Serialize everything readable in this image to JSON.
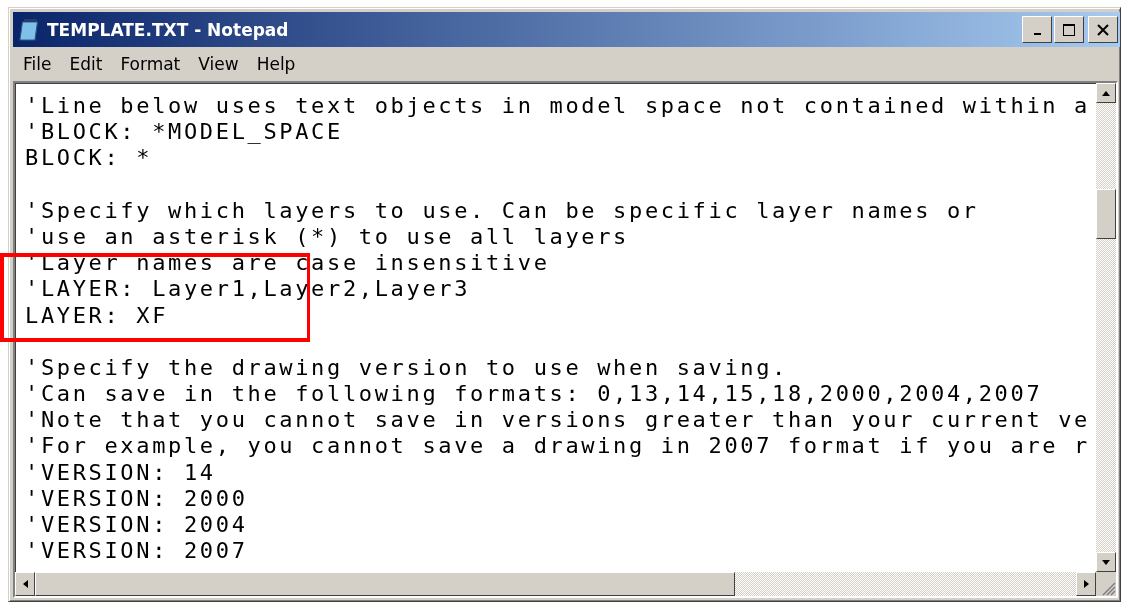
{
  "window": {
    "title": "TEMPLATE.TXT - Notepad"
  },
  "menu": [
    {
      "label": "File"
    },
    {
      "label": "Edit"
    },
    {
      "label": "Format"
    },
    {
      "label": "View"
    },
    {
      "label": "Help"
    }
  ],
  "editor": {
    "lines": [
      {
        "kind": "text",
        "text": "'Line below uses text objects in model space not contained within a"
      },
      {
        "kind": "text",
        "text": "'BLOCK: *MODEL_SPACE"
      },
      {
        "kind": "text",
        "text": "BLOCK: *"
      },
      {
        "kind": "blank"
      },
      {
        "kind": "text",
        "text": "'Specify which layers to use. Can be specific layer names or"
      },
      {
        "kind": "text",
        "text": "'use an asterisk (*) to use all layers"
      },
      {
        "kind": "text",
        "text": "'Layer names are case insensitive"
      },
      {
        "kind": "text",
        "text": "'LAYER: Layer1,Layer2,Layer3"
      },
      {
        "kind": "text",
        "text": "LAYER: XF"
      },
      {
        "kind": "blank"
      },
      {
        "kind": "text",
        "text": "'Specify the drawing version to use when saving."
      },
      {
        "kind": "text",
        "text": "'Can save in the following formats: 0,13,14,15,18,2000,2004,2007"
      },
      {
        "kind": "text",
        "text": "'Note that you cannot save in versions greater than your current ve"
      },
      {
        "kind": "text",
        "text": "'For example, you cannot save a drawing in 2007 format if you are r"
      },
      {
        "kind": "text",
        "text": "'VERSION: 14"
      },
      {
        "kind": "text",
        "text": "'VERSION: 2000"
      },
      {
        "kind": "text",
        "text": "'VERSION: 2004"
      },
      {
        "kind": "text",
        "text": "'VERSION: 2007"
      }
    ]
  },
  "annotation": {
    "kind": "rectangle"
  }
}
